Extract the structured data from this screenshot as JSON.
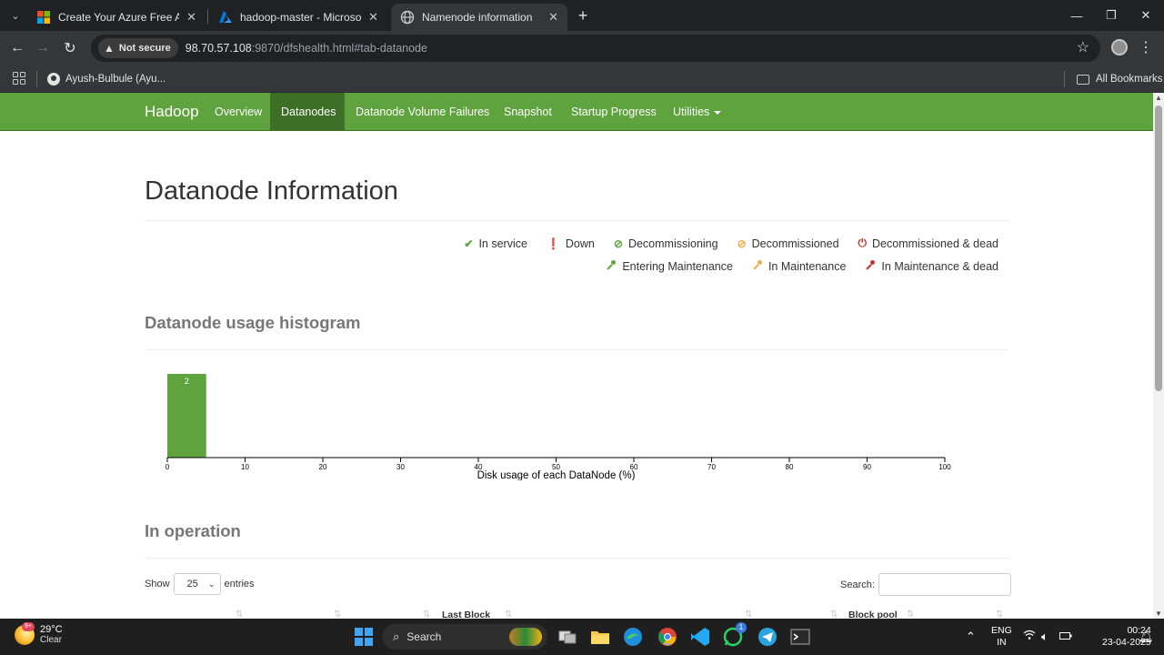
{
  "browser": {
    "tabs": [
      {
        "title": "Create Your Azure Free Account",
        "active": false
      },
      {
        "title": "hadoop-master - Microsoft Azure",
        "active": false
      },
      {
        "title": "Namenode information",
        "active": true
      }
    ],
    "security_label": "Not secure",
    "url_host": "98.70.57.108",
    "url_rest": ":9870/dfshealth.html#tab-datanode",
    "bookmarks": [
      "Ayush-Bulbule (Ayu...",
      "All Bookmarks"
    ]
  },
  "hadoop_nav": {
    "brand": "Hadoop",
    "items": [
      "Overview",
      "Datanodes",
      "Datanode Volume Failures",
      "Snapshot",
      "Startup Progress",
      "Utilities"
    ],
    "active": "Datanodes"
  },
  "page": {
    "title": "Datanode Information",
    "legend_row1": [
      {
        "icon": "✔",
        "label": "In service",
        "color": "#5fa33e"
      },
      {
        "icon": "❗",
        "label": "Down",
        "color": "#c9302c"
      },
      {
        "icon": "⊘",
        "label": "Decommissioning",
        "color": "#5fa33e"
      },
      {
        "icon": "⊘",
        "label": "Decommissioned",
        "color": "#f0ad4e"
      },
      {
        "icon": "⏻",
        "label": "Decommissioned & dead",
        "color": "#c9302c"
      }
    ],
    "legend_row2": [
      {
        "icon": "🔧",
        "label": "Entering Maintenance",
        "color": "#5fa33e"
      },
      {
        "icon": "🔧",
        "label": "In Maintenance",
        "color": "#f0ad4e"
      },
      {
        "icon": "🔧",
        "label": "In Maintenance & dead",
        "color": "#c9302c"
      }
    ],
    "histogram_title": "Datanode usage histogram",
    "operation_title": "In operation",
    "show_label": "Show",
    "show_value": "25",
    "entries_label": "entries",
    "search_label": "Search:",
    "table_headers": [
      "",
      "",
      "Last Block",
      "",
      "Block pool",
      ""
    ]
  },
  "chart_data": {
    "type": "bar",
    "bins": [
      {
        "x0": 0,
        "x1": 5,
        "count": 2
      }
    ],
    "values": [
      2
    ],
    "data_labels": [
      "2"
    ],
    "xlabel": "Disk usage of each DataNode (%)",
    "xlim": [
      0,
      100
    ],
    "xticks": [
      0,
      10,
      20,
      30,
      40,
      50,
      60,
      70,
      80,
      90,
      100
    ],
    "bar_color": "#5fa33e"
  },
  "taskbar": {
    "temperature": "29°C",
    "condition": "Clear",
    "weather_badge": "9+",
    "search_label": "Search",
    "lang_line1": "ENG",
    "lang_line2": "IN",
    "time": "00:24",
    "date": "23-04-2025",
    "whatsapp_badge": "1"
  }
}
